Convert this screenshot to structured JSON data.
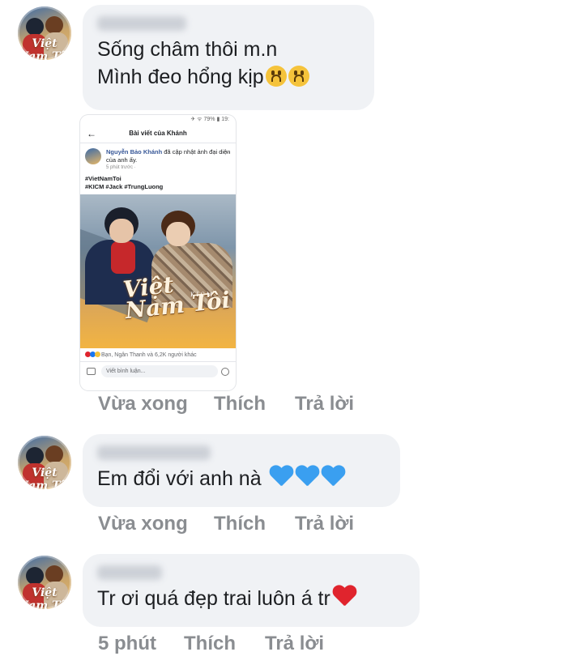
{
  "comments": [
    {
      "text": "Sống châm thôi m.n\nMình đeo hổng kịp",
      "emojis": [
        "upside-down-face-icon",
        "upside-down-face-icon"
      ],
      "time": "Vừa xong",
      "like_label": "Thích",
      "reply_label": "Trả lời"
    },
    {
      "text": "Em đổi với anh nà",
      "emojis": [
        "blue-heart-icon",
        "blue-heart-icon",
        "blue-heart-icon"
      ],
      "time": "Vừa xong",
      "like_label": "Thích",
      "reply_label": "Trả lời"
    },
    {
      "text": "Tr ơi quá đẹp trai luôn á tr",
      "emojis": [
        "red-heart-icon"
      ],
      "time": "5 phút",
      "like_label": "Thích",
      "reply_label": "Trả lời"
    }
  ],
  "avatar_logo": "Việt Nam Tôi",
  "embedded": {
    "status": "✈ ᯤ 79% ▮ 19:",
    "header": "Bài viết của Khánh",
    "author": "Nguyễn Bảo Khánh",
    "action": "đã cập nhật ảnh đại diện của anh ấy.",
    "time": "5 phút trước ·",
    "tags_line1": "#VietNamToi",
    "tags_line2": "#KICM #Jack #TrungLuong",
    "image_title": "Việt Nam Tôi",
    "image_subtitle": "K I C M",
    "reactions": "Bạn, Ngân Thanh và 6,2K người khác",
    "comment_placeholder": "Viết bình luận..."
  },
  "colors": {
    "bubble": "#f0f2f5",
    "meta_text": "#8a8d91",
    "blue_heart": "#3a9ff0",
    "red_heart": "#e0242d"
  }
}
